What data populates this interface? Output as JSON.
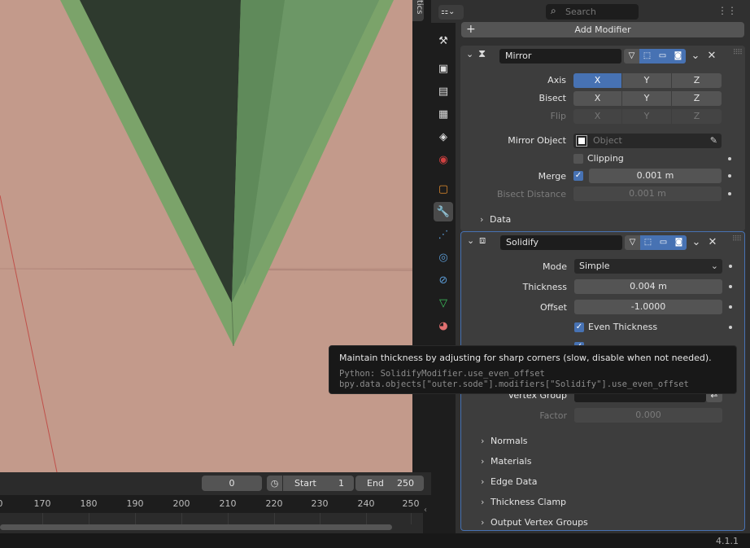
{
  "viewport": {
    "side_tab_label": "tics"
  },
  "timeline": {
    "current_frame": "0",
    "start_label": "Start",
    "start_value": "1",
    "end_label": "End",
    "end_value": "250",
    "ticks": [
      "0",
      "170",
      "180",
      "190",
      "200",
      "210",
      "220",
      "230",
      "240",
      "250"
    ]
  },
  "header": {
    "search_placeholder": "Search"
  },
  "add_modifier_label": "Add Modifier",
  "mirror": {
    "name": "Mirror",
    "axis_label": "Axis",
    "bisect_label": "Bisect",
    "flip_label": "Flip",
    "x": "X",
    "y": "Y",
    "z": "Z",
    "mirror_object_label": "Mirror Object",
    "object_placeholder": "Object",
    "clipping_label": "Clipping",
    "merge_label": "Merge",
    "merge_value": "0.001 m",
    "bisect_distance_label": "Bisect Distance",
    "bisect_distance_value": "0.001 m",
    "data_label": "Data"
  },
  "solidify": {
    "name": "Solidify",
    "mode_label": "Mode",
    "mode_value": "Simple",
    "thickness_label": "Thickness",
    "thickness_value": "0.004 m",
    "offset_label": "Offset",
    "offset_value": "-1.0000",
    "even_thickness_label": "Even Thickness",
    "vertex_group_label": "Vertex Group",
    "factor_label": "Factor",
    "factor_value": "0.000",
    "subpanels": [
      "Normals",
      "Materials",
      "Edge Data",
      "Thickness Clamp",
      "Output Vertex Groups"
    ]
  },
  "tooltip": {
    "description": "Maintain thickness by adjusting for sharp corners (slow, disable when not needed).",
    "python_line1": "Python: SolidifyModifier.use_even_offset",
    "python_line2": "bpy.data.objects[\"outer.sode\"].modifiers[\"Solidify\"].use_even_offset"
  },
  "status": {
    "version": "4.1.1"
  },
  "colors": {
    "accent": "#4772b3",
    "viewport_bg": "#c39a8b",
    "mesh_green": "#7ba36a"
  }
}
